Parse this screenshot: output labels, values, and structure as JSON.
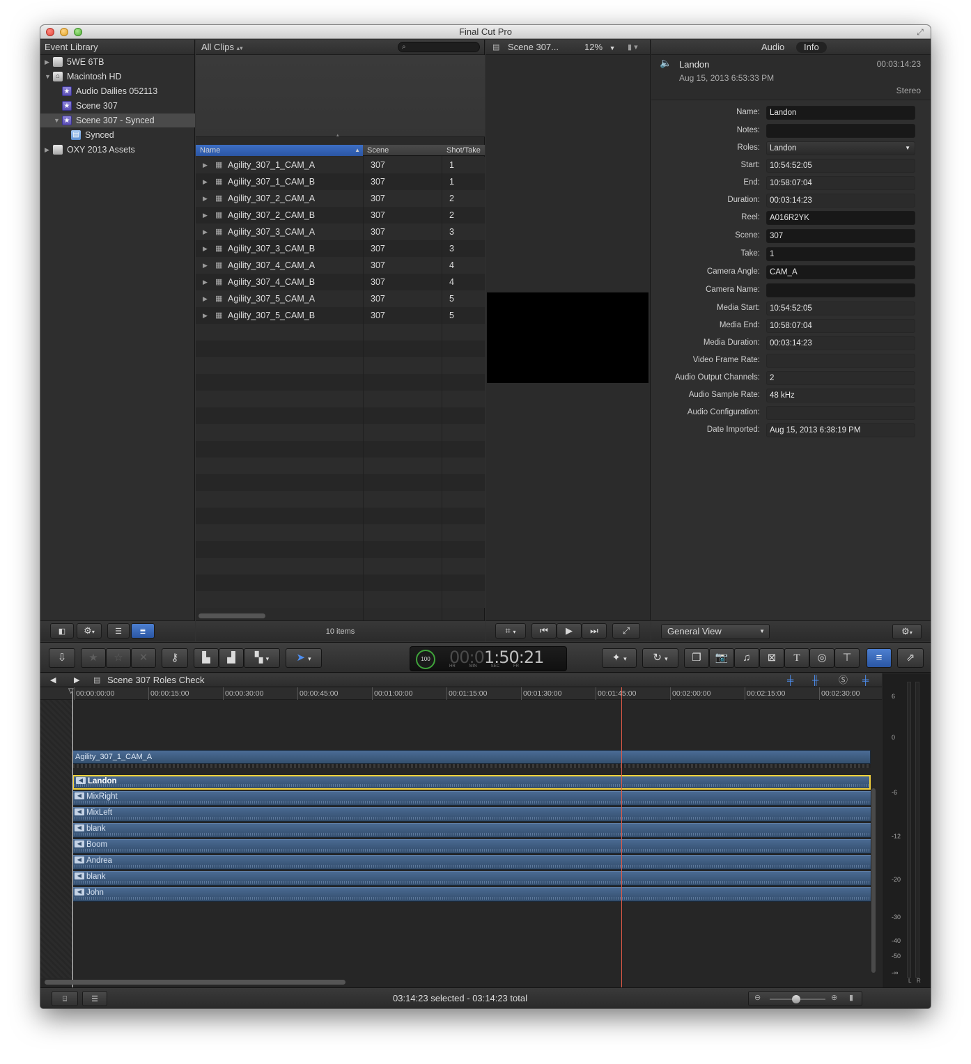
{
  "window": {
    "title": "Final Cut Pro"
  },
  "event_library": {
    "header": "Event Library",
    "items": [
      {
        "label": "5WE 6TB",
        "icon": "drive-icon",
        "indent": 0,
        "expanded": false
      },
      {
        "label": "Macintosh HD",
        "icon": "home-drive-icon",
        "indent": 0,
        "expanded": true
      },
      {
        "label": "Audio Dailies 052113",
        "icon": "event-star-icon",
        "indent": 1
      },
      {
        "label": "Scene 307",
        "icon": "event-star-icon",
        "indent": 1
      },
      {
        "label": "Scene 307 - Synced",
        "icon": "event-star-icon",
        "indent": 1,
        "expanded": true,
        "selected": true
      },
      {
        "label": "Synced",
        "icon": "project-icon",
        "indent": 2
      },
      {
        "label": "OXY 2013 Assets",
        "icon": "drive-icon",
        "indent": 0,
        "expanded": false
      }
    ]
  },
  "browser": {
    "filter": "All Clips",
    "search_placeholder": "",
    "columns": [
      "Name",
      "Scene",
      "Shot/Take"
    ],
    "rows": [
      {
        "name": "Agility_307_1_CAM_A",
        "scene": "307",
        "take": "1"
      },
      {
        "name": "Agility_307_1_CAM_B",
        "scene": "307",
        "take": "1"
      },
      {
        "name": "Agility_307_2_CAM_A",
        "scene": "307",
        "take": "2"
      },
      {
        "name": "Agility_307_2_CAM_B",
        "scene": "307",
        "take": "2"
      },
      {
        "name": "Agility_307_3_CAM_A",
        "scene": "307",
        "take": "3"
      },
      {
        "name": "Agility_307_3_CAM_B",
        "scene": "307",
        "take": "3"
      },
      {
        "name": "Agility_307_4_CAM_A",
        "scene": "307",
        "take": "4"
      },
      {
        "name": "Agility_307_4_CAM_B",
        "scene": "307",
        "take": "4"
      },
      {
        "name": "Agility_307_5_CAM_A",
        "scene": "307",
        "take": "5"
      },
      {
        "name": "Agility_307_5_CAM_B",
        "scene": "307",
        "take": "5"
      }
    ],
    "count": "10 items"
  },
  "viewer": {
    "title": "Scene 307...",
    "zoom": "12%"
  },
  "inspector": {
    "tabs": [
      "Audio",
      "Info"
    ],
    "active_tab": "Info",
    "clip_name": "Landon",
    "clip_duration": "00:03:14:23",
    "clip_date": "Aug 15, 2013 6:53:33 PM",
    "channel_mode": "Stereo",
    "fields": [
      {
        "label": "Name:",
        "value": "Landon"
      },
      {
        "label": "Notes:",
        "value": ""
      },
      {
        "label": "Roles:",
        "value": "Landon"
      },
      {
        "label": "Start:",
        "value": "10:54:52:05"
      },
      {
        "label": "End:",
        "value": "10:58:07:04"
      },
      {
        "label": "Duration:",
        "value": "00:03:14:23"
      },
      {
        "label": "Reel:",
        "value": "A016R2YK"
      },
      {
        "label": "Scene:",
        "value": "307"
      },
      {
        "label": "Take:",
        "value": "1"
      },
      {
        "label": "Camera Angle:",
        "value": "CAM_A"
      },
      {
        "label": "Camera Name:",
        "value": ""
      },
      {
        "label": "Media Start:",
        "value": "10:54:52:05"
      },
      {
        "label": "Media End:",
        "value": "10:58:07:04"
      },
      {
        "label": "Media Duration:",
        "value": "00:03:14:23"
      },
      {
        "label": "Video Frame Rate:",
        "value": ""
      },
      {
        "label": "Audio Output Channels:",
        "value": "2"
      },
      {
        "label": "Audio Sample Rate:",
        "value": "48 kHz"
      },
      {
        "label": "Audio Configuration:",
        "value": ""
      },
      {
        "label": "Date Imported:",
        "value": "Aug 15, 2013 6:38:19 PM"
      }
    ],
    "view_select": "General View"
  },
  "toolbar": {
    "timecode": "00:01:50:21",
    "timecode_dim": "00:0",
    "timecode_bright": "1:50:21",
    "timecode_units": [
      "HR",
      "MIN",
      "SEC",
      "FR"
    ],
    "percent": "100"
  },
  "timeline": {
    "project": "Scene 307 Roles Check",
    "ruler": [
      "00:00:00:00",
      "00:00:15:00",
      "00:00:30:00",
      "00:00:45:00",
      "00:01:00:00",
      "00:01:15:00",
      "00:01:30:00",
      "00:01:45:00",
      "00:02:00:00",
      "00:02:15:00",
      "00:02:30:00"
    ],
    "video_clip": "Agility_307_1_CAM_A",
    "audio_tracks": [
      "Landon",
      "MixRight",
      "MixLeft",
      "blank",
      "Boom",
      "Andrea",
      "blank",
      "John"
    ],
    "selected_track": "Landon",
    "status": "03:14:23 selected - 03:14:23 total"
  },
  "meters": {
    "scale": [
      "6",
      "0",
      "-6",
      "-12",
      "-20",
      "-30",
      "-40",
      "-50",
      "-∞"
    ],
    "channels": [
      "L",
      "R"
    ]
  },
  "colors": {
    "accent": "#2b56a4",
    "clip": "#4a6a92",
    "selection": "#f5d33a",
    "playhead": "#e05a47"
  }
}
